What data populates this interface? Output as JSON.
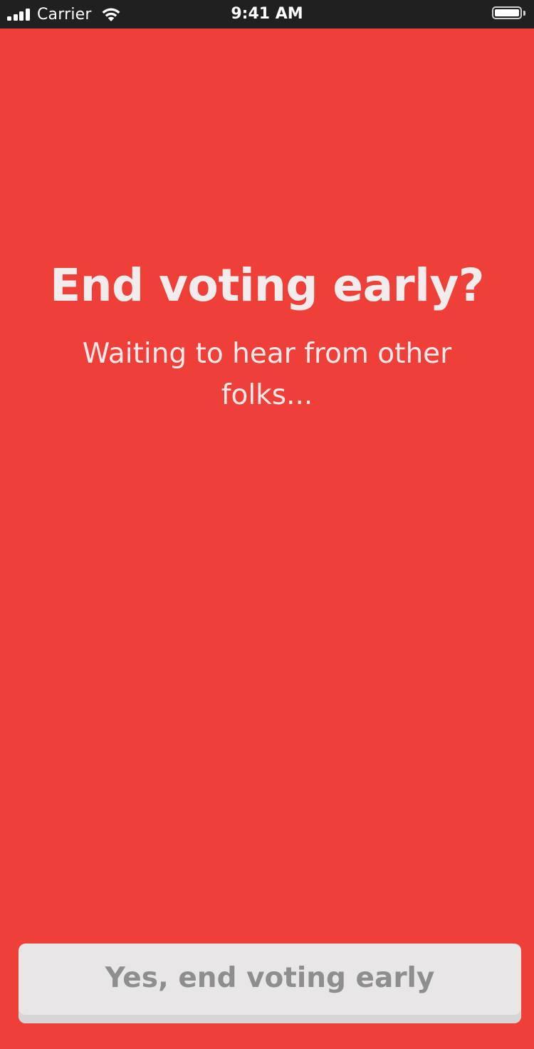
{
  "status_bar": {
    "carrier": "Carrier",
    "time": "9:41 AM"
  },
  "main": {
    "title": "End voting early?",
    "subtitle": "Waiting to hear from other folks..."
  },
  "actions": {
    "end_voting_label": "Yes, end voting early"
  },
  "colors": {
    "background": "#EE3F39",
    "button_background": "#E8E6E7",
    "button_text": "#8E8E8E"
  }
}
